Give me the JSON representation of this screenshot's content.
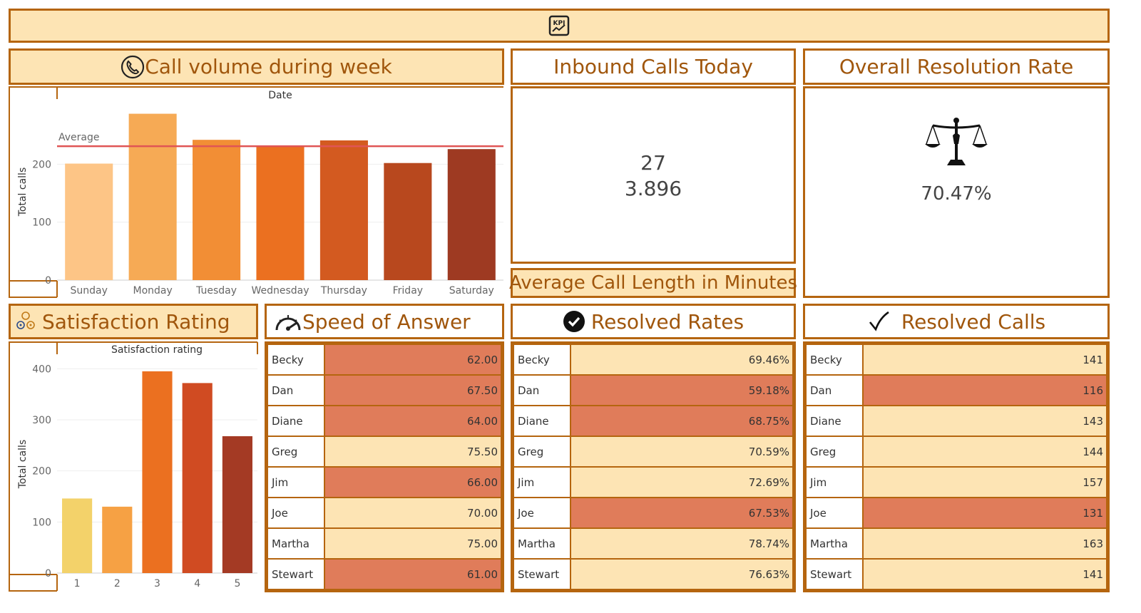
{
  "banner": {
    "icon": "kpi-chart-icon"
  },
  "call_volume": {
    "title": "Call volume during week",
    "icon": "phone-icon",
    "xlabel": "Date",
    "ylabel": "Total calls",
    "avg_label": "Average"
  },
  "inbound": {
    "title": "Inbound Calls Today",
    "value1": "27",
    "value2": "3.896"
  },
  "avg_length": {
    "title": "Average Call Length in Minutes"
  },
  "resolution": {
    "title": "Overall Resolution Rate",
    "icon": "scales-icon",
    "value": "70.47%"
  },
  "satisfaction": {
    "title": "Satisfaction Rating",
    "icon": "rating-icon",
    "xlabel": "Satisfaction rating",
    "ylabel": "Total calls"
  },
  "speed": {
    "title": "Speed of Answer",
    "icon": "speedometer-icon",
    "rows": [
      {
        "name": "Becky",
        "value": "62.00",
        "hi": true
      },
      {
        "name": "Dan",
        "value": "67.50",
        "hi": true
      },
      {
        "name": "Diane",
        "value": "64.00",
        "hi": true
      },
      {
        "name": "Greg",
        "value": "75.50",
        "hi": false
      },
      {
        "name": "Jim",
        "value": "66.00",
        "hi": true
      },
      {
        "name": "Joe",
        "value": "70.00",
        "hi": false
      },
      {
        "name": "Martha",
        "value": "75.00",
        "hi": false
      },
      {
        "name": "Stewart",
        "value": "61.00",
        "hi": true
      }
    ]
  },
  "resolved_rates": {
    "title": "Resolved Rates",
    "icon": "check-circle-icon",
    "rows": [
      {
        "name": "Becky",
        "value": "69.46%",
        "hi": false
      },
      {
        "name": "Dan",
        "value": "59.18%",
        "hi": true
      },
      {
        "name": "Diane",
        "value": "68.75%",
        "hi": true
      },
      {
        "name": "Greg",
        "value": "70.59%",
        "hi": false
      },
      {
        "name": "Jim",
        "value": "72.69%",
        "hi": false
      },
      {
        "name": "Joe",
        "value": "67.53%",
        "hi": true
      },
      {
        "name": "Martha",
        "value": "78.74%",
        "hi": false
      },
      {
        "name": "Stewart",
        "value": "76.63%",
        "hi": false
      }
    ]
  },
  "resolved_calls": {
    "title": "Resolved Calls",
    "icon": "checkmark-icon",
    "rows": [
      {
        "name": "Becky",
        "value": "141",
        "hi": false
      },
      {
        "name": "Dan",
        "value": "116",
        "hi": true
      },
      {
        "name": "Diane",
        "value": "143",
        "hi": false
      },
      {
        "name": "Greg",
        "value": "144",
        "hi": false
      },
      {
        "name": "Jim",
        "value": "157",
        "hi": false
      },
      {
        "name": "Joe",
        "value": "131",
        "hi": true
      },
      {
        "name": "Martha",
        "value": "163",
        "hi": false
      },
      {
        "name": "Stewart",
        "value": "141",
        "hi": false
      }
    ]
  },
  "colors": {
    "border": "#b5650f",
    "header_bg": "#fde4b4",
    "highlight": "#e07c5a",
    "avg_line": "#e05555"
  },
  "chart_data": [
    {
      "type": "bar",
      "categories": [
        "Sunday",
        "Monday",
        "Tuesday",
        "Wednesday",
        "Thursday",
        "Friday",
        "Saturday"
      ],
      "values": [
        201,
        287,
        242,
        232,
        241,
        202,
        226
      ],
      "colors": [
        "#fdc586",
        "#f6aa55",
        "#f28e35",
        "#eb7020",
        "#d35a20",
        "#b8481e",
        "#9e3a22"
      ],
      "average": 231,
      "average_label": "Average",
      "xlabel": "Date",
      "ylabel": "Total calls",
      "yticks": [
        0,
        100,
        200
      ],
      "ylim": [
        0,
        300
      ],
      "grid": true
    },
    {
      "type": "bar",
      "categories": [
        "1",
        "2",
        "3",
        "4",
        "5"
      ],
      "values": [
        146,
        130,
        395,
        372,
        268
      ],
      "colors": [
        "#f3d26a",
        "#f6a144",
        "#eb7020",
        "#d04b22",
        "#a43a24"
      ],
      "xlabel": "Satisfaction rating",
      "ylabel": "Total calls",
      "yticks": [
        0,
        100,
        200,
        300,
        400
      ],
      "ylim": [
        0,
        420
      ],
      "grid": true
    }
  ]
}
